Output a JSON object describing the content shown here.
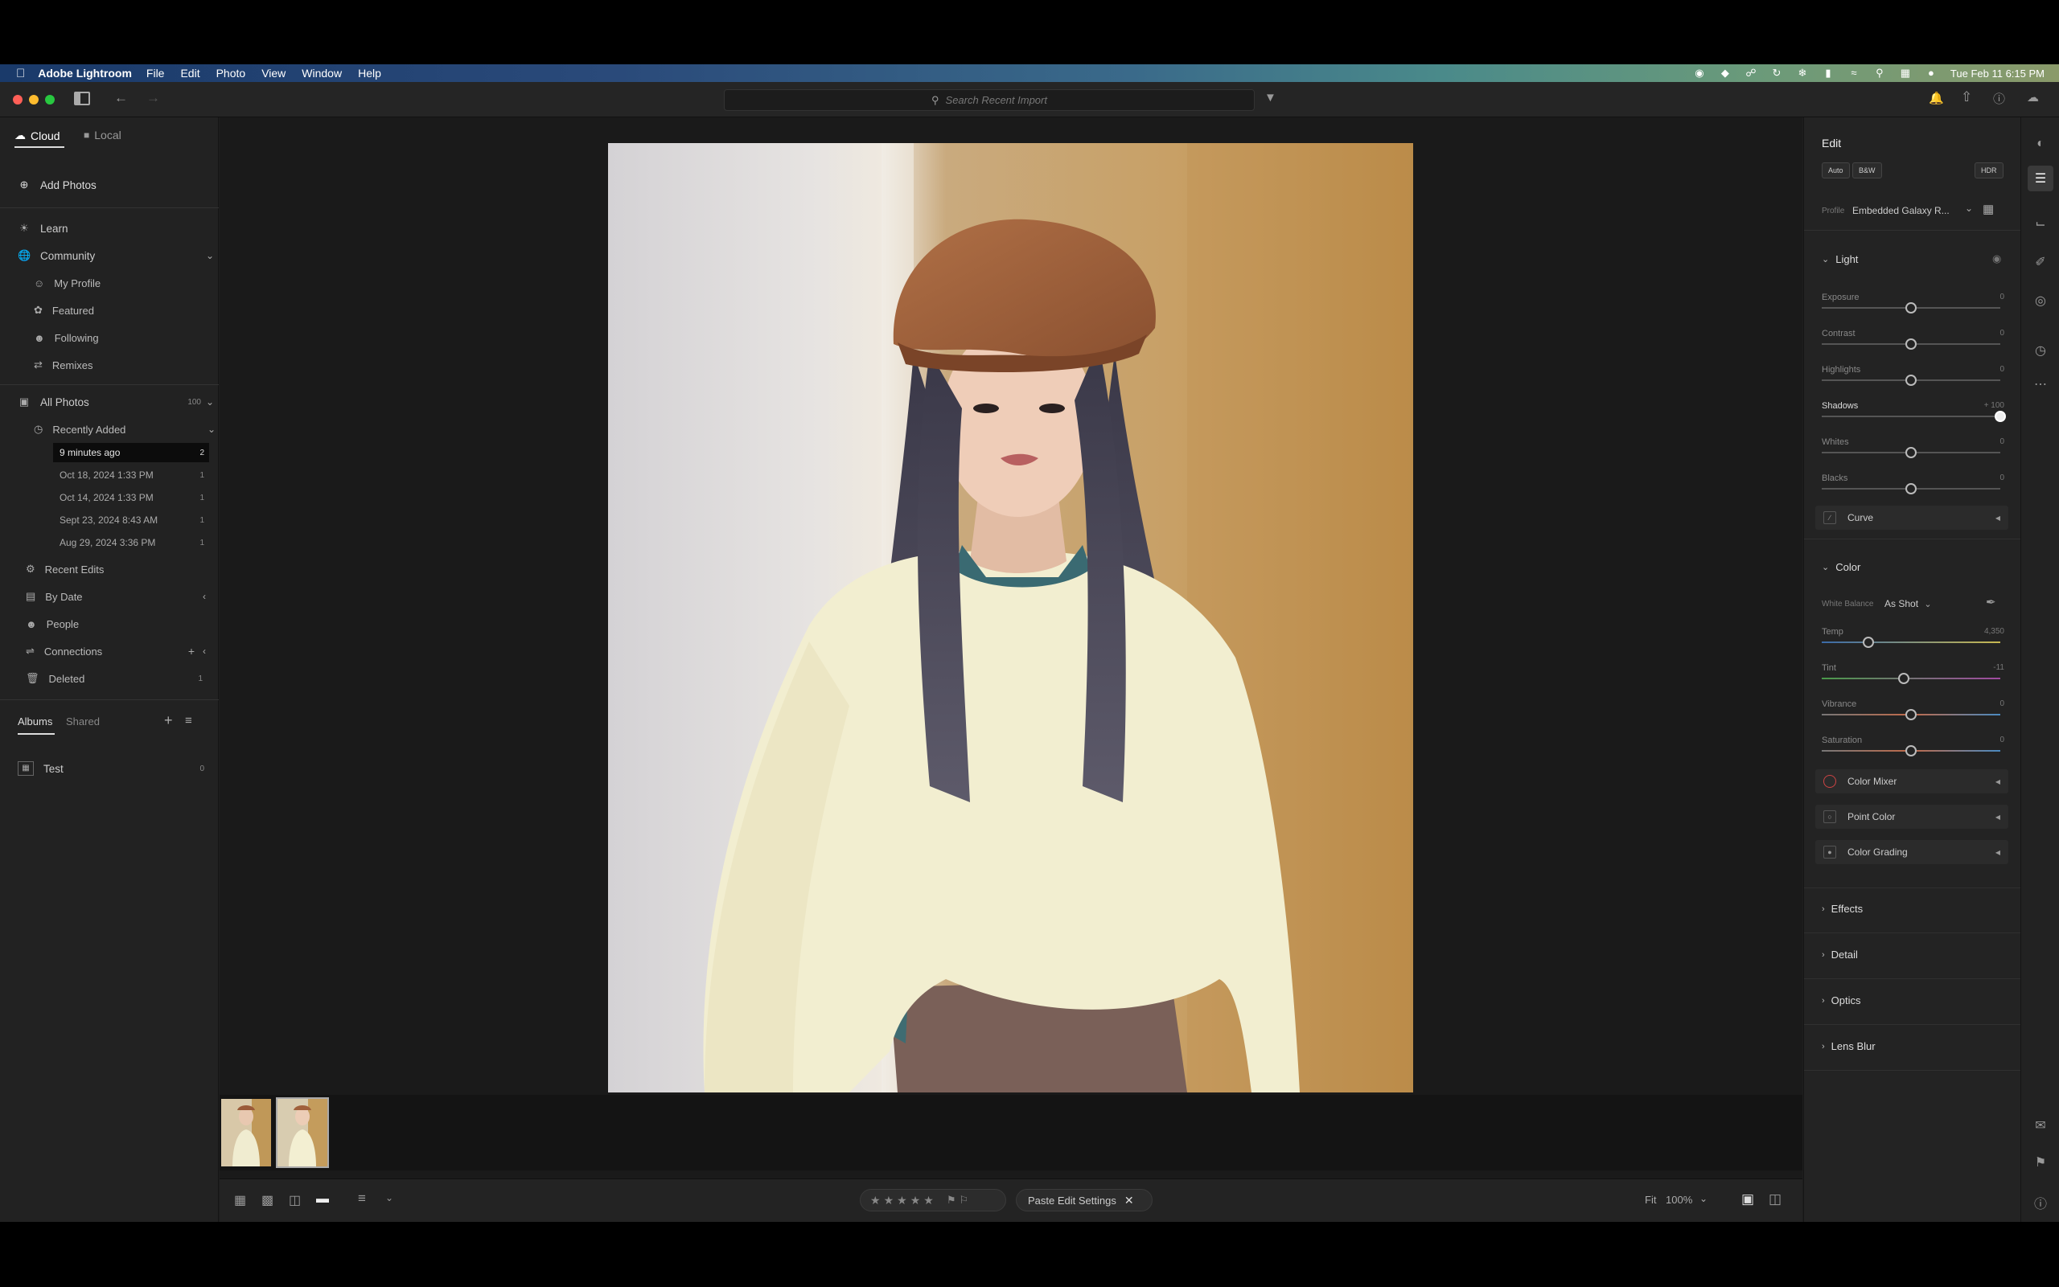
{
  "menubar": {
    "app_name": "Adobe Lightroom",
    "menus": [
      "File",
      "Edit",
      "Photo",
      "View",
      "Window",
      "Help"
    ],
    "clock": "Tue Feb 11  6:15 PM"
  },
  "toolbar": {
    "search_placeholder": "Search Recent Import"
  },
  "left": {
    "tab_cloud": "Cloud",
    "tab_local": "Local",
    "add_photos": "Add Photos",
    "learn": "Learn",
    "community": "Community",
    "community_items": [
      "My Profile",
      "Featured",
      "Following",
      "Remixes"
    ],
    "all_photos": "All Photos",
    "all_photos_count": "100",
    "recently_added": "Recently Added",
    "dates": [
      {
        "label": "9 minutes ago",
        "count": "2"
      },
      {
        "label": "Oct 18, 2024 1:33 PM",
        "count": "1"
      },
      {
        "label": "Oct 14, 2024 1:33 PM",
        "count": "1"
      },
      {
        "label": "Sept 23, 2024 8:43 AM",
        "count": "1"
      },
      {
        "label": "Aug 29, 2024 3:36 PM",
        "count": "1"
      }
    ],
    "recent_edits": "Recent Edits",
    "by_date": "By Date",
    "people": "People",
    "connections": "Connections",
    "deleted": "Deleted",
    "deleted_count": "1",
    "albums_tab": "Albums",
    "shared_tab": "Shared",
    "album_name": "Test",
    "album_count": "0"
  },
  "bottom": {
    "paste_label": "Paste Edit Settings",
    "fit_label": "Fit",
    "zoom_label": "100%"
  },
  "edit": {
    "title": "Edit",
    "auto": "Auto",
    "bw": "B&W",
    "hdr": "HDR",
    "profile_label": "Profile",
    "profile_value": "Embedded Galaxy R...",
    "light_title": "Light",
    "light_sliders": [
      {
        "label": "Exposure",
        "value": "0",
        "pos": 0.5
      },
      {
        "label": "Contrast",
        "value": "0",
        "pos": 0.5
      },
      {
        "label": "Highlights",
        "value": "0",
        "pos": 0.5
      },
      {
        "label": "Shadows",
        "value": "+ 100",
        "pos": 1.0
      },
      {
        "label": "Whites",
        "value": "0",
        "pos": 0.5
      },
      {
        "label": "Blacks",
        "value": "0",
        "pos": 0.5
      }
    ],
    "curve": "Curve",
    "color_title": "Color",
    "wb_label": "White Balance",
    "wb_value": "As Shot",
    "color_sliders": [
      {
        "label": "Temp",
        "value": "4,350",
        "pos": 0.26
      },
      {
        "label": "Tint",
        "value": "-11",
        "pos": 0.46
      },
      {
        "label": "Vibrance",
        "value": "0",
        "pos": 0.5
      },
      {
        "label": "Saturation",
        "value": "0",
        "pos": 0.5
      }
    ],
    "color_mixer": "Color Mixer",
    "point_color": "Point Color",
    "color_grading": "Color Grading",
    "effects": "Effects",
    "detail": "Detail",
    "optics": "Optics",
    "lens_blur": "Lens Blur"
  },
  "colors": {
    "accent": "#ffffff",
    "panel": "#232323",
    "menubar_start": "#1a3a6a",
    "menubar_end": "#8a9a6a"
  }
}
